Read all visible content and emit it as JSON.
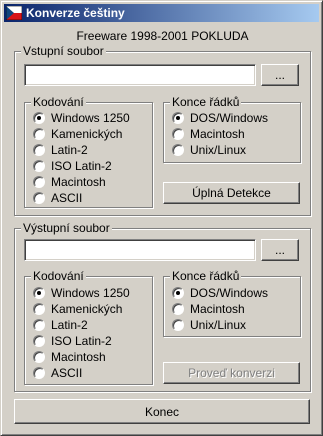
{
  "window": {
    "title": "Konverze češtiny"
  },
  "header": "Freeware 1998-2001  POKLUDA",
  "input_section": {
    "label": "Vstupní soubor",
    "path_value": "",
    "browse_label": "...",
    "encoding": {
      "label": "Kodování",
      "options": [
        "Windows 1250",
        "Kamenických",
        "Latin-2",
        "ISO Latin-2",
        "Macintosh",
        "ASCII"
      ],
      "selected": "Windows 1250"
    },
    "line_endings": {
      "label": "Konce řádků",
      "options": [
        "DOS/Windows",
        "Macintosh",
        "Unix/Linux"
      ],
      "selected": "DOS/Windows"
    },
    "detect_label": "Úplná Detekce"
  },
  "output_section": {
    "label": "Výstupní soubor",
    "path_value": "",
    "browse_label": "...",
    "encoding": {
      "label": "Kodování",
      "options": [
        "Windows 1250",
        "Kamenických",
        "Latin-2",
        "ISO Latin-2",
        "Macintosh",
        "ASCII"
      ],
      "selected": "Windows 1250"
    },
    "line_endings": {
      "label": "Konce řádků",
      "options": [
        "DOS/Windows",
        "Macintosh",
        "Unix/Linux"
      ],
      "selected": "DOS/Windows"
    },
    "convert_label": "Proveď konverzi",
    "convert_enabled": false
  },
  "footer": {
    "end_label": "Konec"
  }
}
